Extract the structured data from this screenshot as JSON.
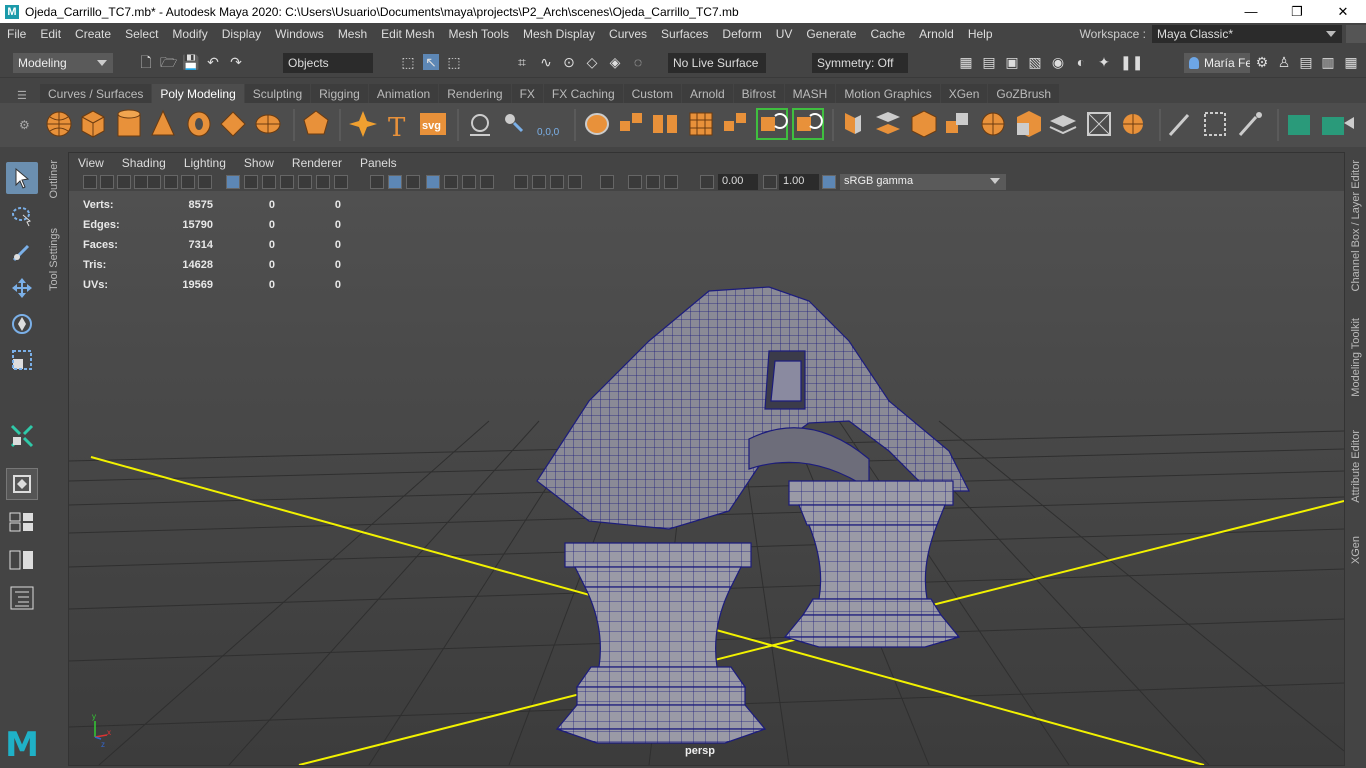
{
  "window": {
    "title": "Ojeda_Carrillo_TC7.mb* - Autodesk Maya 2020: C:\\Users\\Usuario\\Documents\\maya\\projects\\P2_Arch\\scenes\\Ojeda_Carrillo_TC7.mb",
    "logo": "M",
    "minimize": "—",
    "restore": "❐",
    "close": "✕"
  },
  "menubar": {
    "items": [
      "File",
      "Edit",
      "Create",
      "Select",
      "Modify",
      "Display",
      "Windows",
      "Mesh",
      "Edit Mesh",
      "Mesh Tools",
      "Mesh Display",
      "Curves",
      "Surfaces",
      "Deform",
      "UV",
      "Generate",
      "Cache",
      "Arnold",
      "Help"
    ],
    "workspace_label": "Workspace :",
    "workspace_value": "Maya Classic*"
  },
  "statusline": {
    "mode": "Modeling",
    "objects": "Objects",
    "live_surface": "No Live Surface",
    "symmetry": "Symmetry: Off",
    "user": "María Fe"
  },
  "shelf": {
    "tabs": [
      "Curves / Surfaces",
      "Poly Modeling",
      "Sculpting",
      "Rigging",
      "Animation",
      "Rendering",
      "FX",
      "FX Caching",
      "Custom",
      "Arnold",
      "Bifrost",
      "MASH",
      "Motion Graphics",
      "XGen",
      "GoZBrush"
    ],
    "active_tab": "Poly Modeling",
    "svg_label": "svg",
    "text_label": "T",
    "coords_label": "0,0,0"
  },
  "left_panel": {
    "outliner": "Outliner",
    "tool_settings": "Tool Settings"
  },
  "right_panel": {
    "channel_box": "Channel Box / Layer Editor",
    "modeling_toolkit": "Modeling Toolkit",
    "attribute_editor": "Attribute Editor",
    "xgen": "XGen"
  },
  "viewport": {
    "menu": [
      "View",
      "Shading",
      "Lighting",
      "Show",
      "Renderer",
      "Panels"
    ],
    "exposure": "0.00",
    "gamma": "1.00",
    "color_space": "sRGB gamma",
    "camera": "persp",
    "hud": [
      {
        "label": "Verts:",
        "v1": "8575",
        "v2": "0",
        "v3": "0"
      },
      {
        "label": "Edges:",
        "v1": "15790",
        "v2": "0",
        "v3": "0"
      },
      {
        "label": "Faces:",
        "v1": "7314",
        "v2": "0",
        "v3": "0"
      },
      {
        "label": "Tris:",
        "v1": "14628",
        "v2": "0",
        "v3": "0"
      },
      {
        "label": "UVs:",
        "v1": "19569",
        "v2": "0",
        "v3": "0"
      }
    ],
    "axis_x": "x",
    "axis_y": "y",
    "axis_z": "z"
  },
  "colors": {
    "shelf_orange": "#e8913a",
    "select_blue": "#6b8fb0",
    "wire_blue": "#1a1a8a",
    "grid_axis": "#ffff00",
    "maya_teal": "#1fb1c7"
  }
}
